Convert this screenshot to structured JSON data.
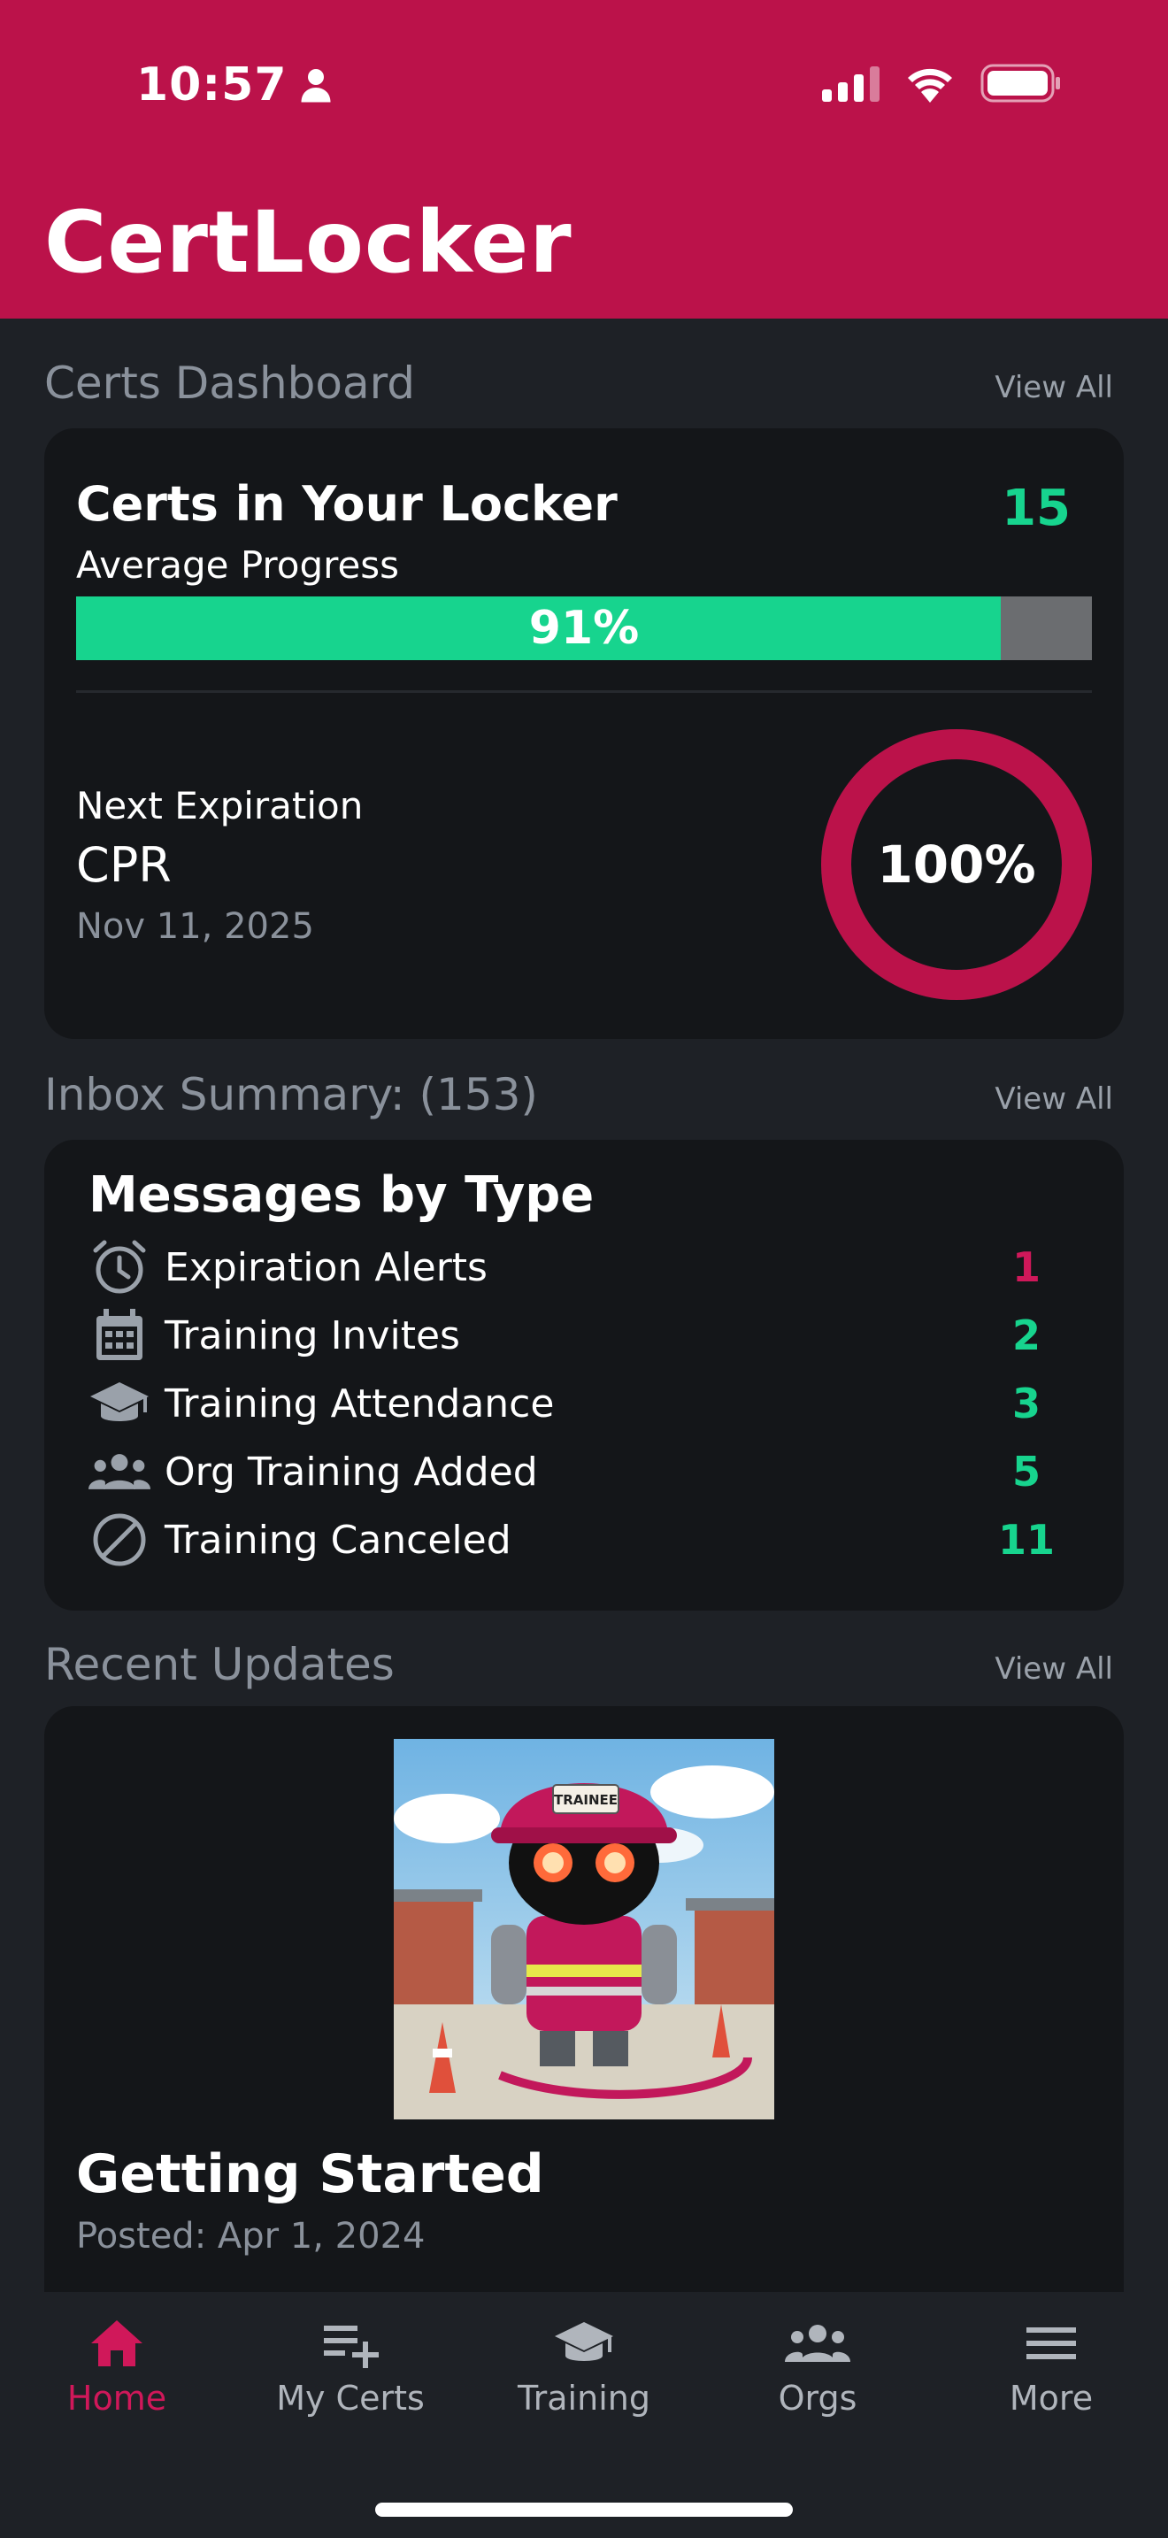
{
  "status_bar": {
    "time": "10:57"
  },
  "app": {
    "title": "CertLocker"
  },
  "colors": {
    "brand": "#bb124a",
    "accent_green": "#17d48e",
    "alert_red": "#d0185a"
  },
  "certs_dashboard": {
    "section_title": "Certs Dashboard",
    "view_all": "View All",
    "card_title": "Certs in Your Locker",
    "count": "15",
    "avg_label": "Average Progress",
    "avg_progress_value": 91,
    "avg_progress_text": "91%",
    "next_label": "Next Expiration",
    "next_name": "CPR",
    "next_date": "Nov 11, 2025",
    "ring_value": 100,
    "ring_text": "100%"
  },
  "inbox": {
    "section_title": "Inbox Summary: (153)",
    "view_all": "View All",
    "card_title": "Messages by Type",
    "rows": [
      {
        "icon": "alarm-clock-icon",
        "label": "Expiration Alerts",
        "count": "1",
        "color": "#d0185a"
      },
      {
        "icon": "calendar-icon",
        "label": "Training Invites",
        "count": "2",
        "color": "#17d48e"
      },
      {
        "icon": "graduation-cap-icon",
        "label": "Training Attendance",
        "count": "3",
        "color": "#17d48e"
      },
      {
        "icon": "group-icon",
        "label": "Org Training Added",
        "count": "5",
        "color": "#17d48e"
      },
      {
        "icon": "cancel-icon",
        "label": "Training Canceled",
        "count": "11",
        "color": "#17d48e"
      }
    ]
  },
  "updates": {
    "section_title": "Recent Updates",
    "view_all": "View All",
    "post_title": "Getting Started",
    "post_date": "Posted: Apr 1, 2024",
    "image_badge": "TRAINEE"
  },
  "nav": {
    "items": [
      {
        "label": "Home",
        "icon": "home-icon",
        "active": true
      },
      {
        "label": "My Certs",
        "icon": "playlist-add-icon",
        "active": false
      },
      {
        "label": "Training",
        "icon": "graduation-cap-icon",
        "active": false
      },
      {
        "label": "Orgs",
        "icon": "group-icon",
        "active": false
      },
      {
        "label": "More",
        "icon": "menu-icon",
        "active": false
      }
    ]
  }
}
